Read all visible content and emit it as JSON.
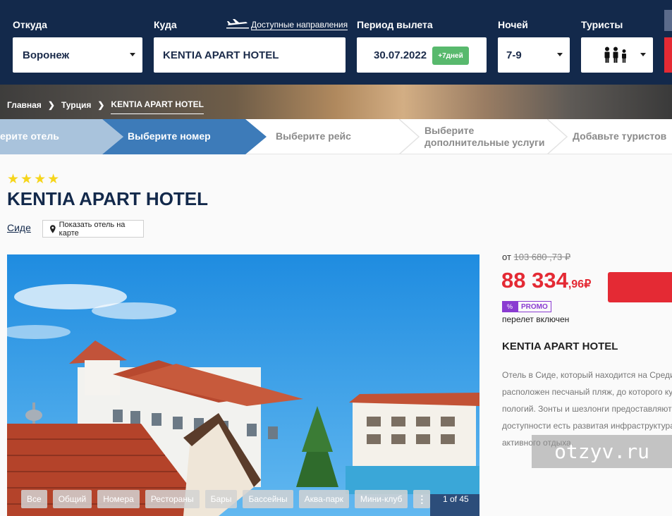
{
  "search": {
    "from_label": "Откуда",
    "from_value": "Воронеж",
    "to_label": "Куда",
    "to_value": "KENTIA APART HOTEL",
    "destinations_link": "Доступные направления",
    "period_label": "Период вылета",
    "period_value": "30.07.2022",
    "period_extra": "+7дней",
    "nights_label": "Ночей",
    "nights_value": "7-9",
    "tourists_label": "Туристы"
  },
  "breadcrumbs": [
    "Главная",
    "Турция",
    "KENTIA APART HOTEL"
  ],
  "steps": {
    "done": "ерите отель",
    "active": "Выберите номер",
    "flight": "Выберите рейс",
    "extras_line1": "Выберите",
    "extras_line2": "дополнительные услуги",
    "tourists": "Добавьте туристов"
  },
  "hotel": {
    "stars": "★★★★",
    "name": "KENTIA APART HOTEL",
    "city": "Сиде",
    "map_button": "Показать отель на карте"
  },
  "gallery": {
    "tags": [
      "Все",
      "Общий",
      "Номера",
      "Рестораны",
      "Бары",
      "Бассейны",
      "Аква-парк",
      "Мини-клуб"
    ],
    "more": "⋮",
    "counter": "1 of 45"
  },
  "price": {
    "from": "от",
    "old": "103 680 ,73 ₽",
    "main": "88 334",
    "cents": ",96₽",
    "promo": "PROMO",
    "flight_included": "перелет включен"
  },
  "side": {
    "title": "KENTIA APART HOTEL",
    "description": [
      "Отель в Сиде, который находится на Средизе",
      "расположен песчаный пляж, до которого кур",
      "пологий. Зонты и шезлонги предоставляютс",
      "доступности есть развитая инфраструктура",
      "активного отдыха."
    ]
  },
  "watermark": "otzyv.ru",
  "colors": {
    "navy": "#13294b",
    "accent_red": "#e42a34",
    "step_active": "#3d7bb9",
    "promo_purple": "#8a3bd1"
  }
}
